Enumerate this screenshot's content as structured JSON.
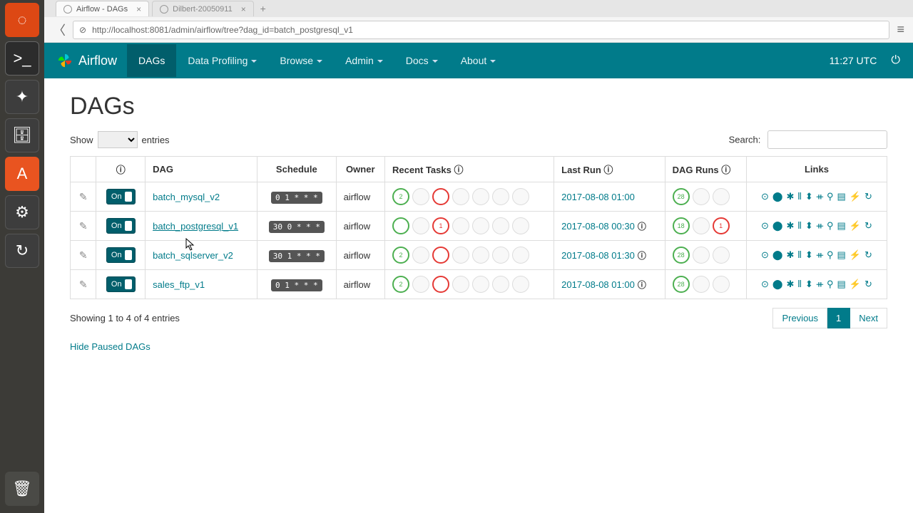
{
  "browser": {
    "tabs": [
      {
        "title": "Airflow - DAGs",
        "active": true
      },
      {
        "title": "Dilbert-20050911",
        "active": false
      }
    ],
    "url": "http://localhost:8081/admin/airflow/tree?dag_id=batch_postgresql_v1"
  },
  "navbar": {
    "brand": "Airflow",
    "items": [
      "DAGs",
      "Data Profiling",
      "Browse",
      "Admin",
      "Docs",
      "About"
    ],
    "clock": "11:27 UTC"
  },
  "page": {
    "heading": "DAGs",
    "show_label": "Show",
    "entries_label": "entries",
    "search_label": "Search:",
    "headers": {
      "dag": "DAG",
      "schedule": "Schedule",
      "owner": "Owner",
      "recent": "Recent Tasks",
      "lastrun": "Last Run",
      "dagruns": "DAG Runs",
      "links": "Links"
    },
    "rows": [
      {
        "toggle": "On",
        "dag": "batch_mysql_v2",
        "schedule": "0 1 * * *",
        "owner": "airflow",
        "recent_green": "2",
        "recent_red": "",
        "lastrun": "2017-08-08 01:00",
        "lastrun_info": false,
        "runs_green": "28",
        "runs_red": "",
        "underline": false
      },
      {
        "toggle": "On",
        "dag": "batch_postgresql_v1",
        "schedule": "30 0 * * *",
        "owner": "airflow",
        "recent_green": "",
        "recent_red": "1",
        "lastrun": "2017-08-08 00:30",
        "lastrun_info": true,
        "runs_green": "18",
        "runs_red": "1",
        "underline": true
      },
      {
        "toggle": "On",
        "dag": "batch_sqlserver_v2",
        "schedule": "30 1 * * *",
        "owner": "airflow",
        "recent_green": "2",
        "recent_red": "",
        "lastrun": "2017-08-08 01:30",
        "lastrun_info": true,
        "runs_green": "28",
        "runs_red": "",
        "underline": false
      },
      {
        "toggle": "On",
        "dag": "sales_ftp_v1",
        "schedule": "0 1 * * *",
        "owner": "airflow",
        "recent_green": "2",
        "recent_red": "",
        "lastrun": "2017-08-08 01:00",
        "lastrun_info": true,
        "runs_green": "28",
        "runs_red": "",
        "underline": false
      }
    ],
    "footer_info": "Showing 1 to 4 of 4 entries",
    "pager": {
      "prev": "Previous",
      "page": "1",
      "next": "Next"
    },
    "hide_link": "Hide Paused DAGs"
  },
  "link_icons": [
    "⊙",
    "⬤",
    "✱",
    "⫴",
    "⬍",
    "ᚑ",
    "⚲",
    "▤",
    "⚡",
    "↻"
  ]
}
